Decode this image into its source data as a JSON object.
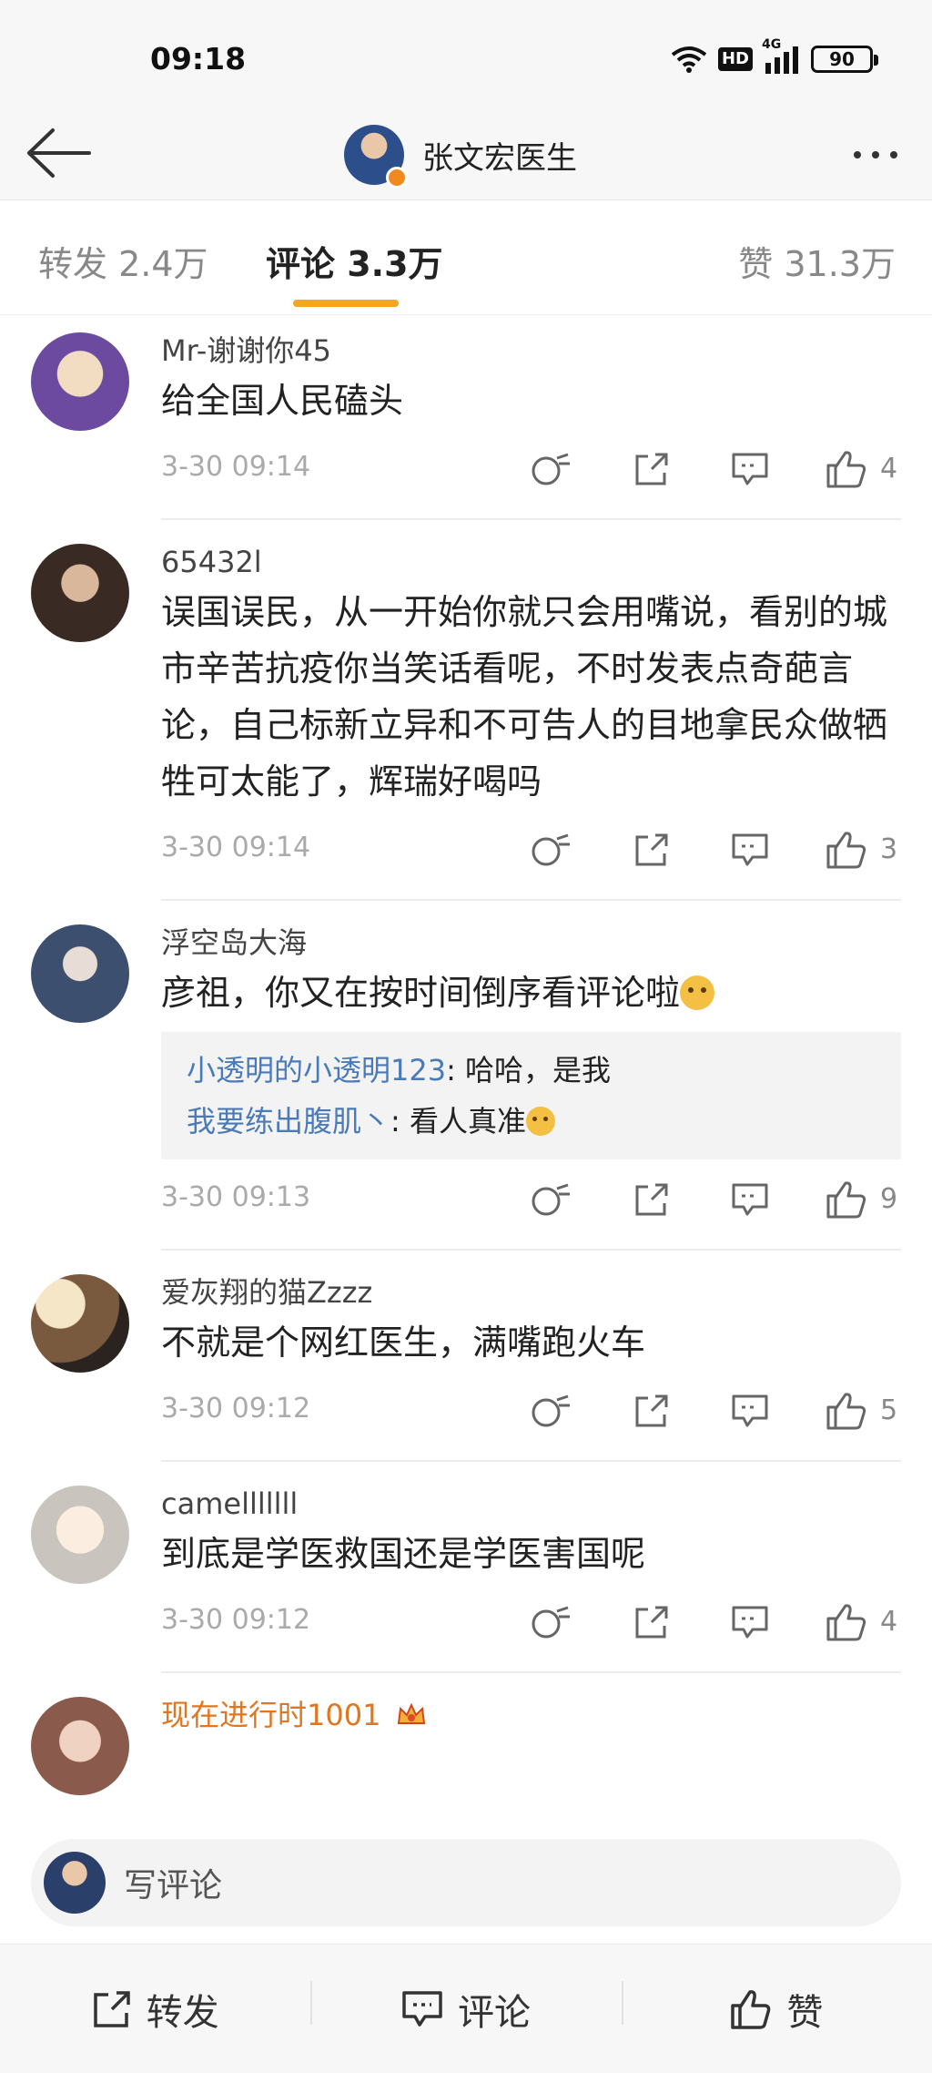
{
  "status_bar": {
    "time": "09:18",
    "hd_label": "HD",
    "network_label": "4G",
    "battery_level": "90"
  },
  "nav": {
    "title": "张文宏医生"
  },
  "tabs": {
    "repost": "转发 2.4万",
    "comment": "评论 3.3万",
    "like": "赞 31.3万",
    "active": "comment"
  },
  "comments": [
    {
      "username": "Mr-谢谢你45",
      "text": "给全国人民磕头",
      "time": "3-30 09:14",
      "likes": "4"
    },
    {
      "username": "65432l",
      "text": "误国误民，从一开始你就只会用嘴说，看别的城市辛苦抗疫你当笑话看呢，不时发表点奇葩言论，自己标新立异和不可告人的目地拿民众做牺牲可太能了，辉瑞好喝吗",
      "time": "3-30 09:14",
      "likes": "3"
    },
    {
      "username": "浮空岛大海",
      "text": "彦祖，你又在按时间倒序看评论啦",
      "emoji": "doge",
      "replies": [
        {
          "user": "小透明的小透明123",
          "text": "哈哈，是我"
        },
        {
          "user": "我要练出腹肌丶",
          "text": "看人真准",
          "emoji": "doge"
        }
      ],
      "time": "3-30 09:13",
      "likes": "9"
    },
    {
      "username": "爱灰翔的猫Zzzz",
      "text": "不就是个网红医生，满嘴跑火车",
      "time": "3-30 09:12",
      "likes": "5"
    },
    {
      "username": "camelllllll",
      "text": "到底是学医救国还是学医害国呢",
      "time": "3-30 09:12",
      "likes": "4"
    },
    {
      "username": "现在进行时1001",
      "badge_icon": "crown-icon"
    }
  ],
  "compose": {
    "placeholder": "写评论"
  },
  "bottom_bar": {
    "repost": "转发",
    "comment": "评论",
    "like": "赞"
  },
  "colors": {
    "accent": "#f5a623",
    "link": "#4a7bb8",
    "gold_username": "#e0761f"
  }
}
